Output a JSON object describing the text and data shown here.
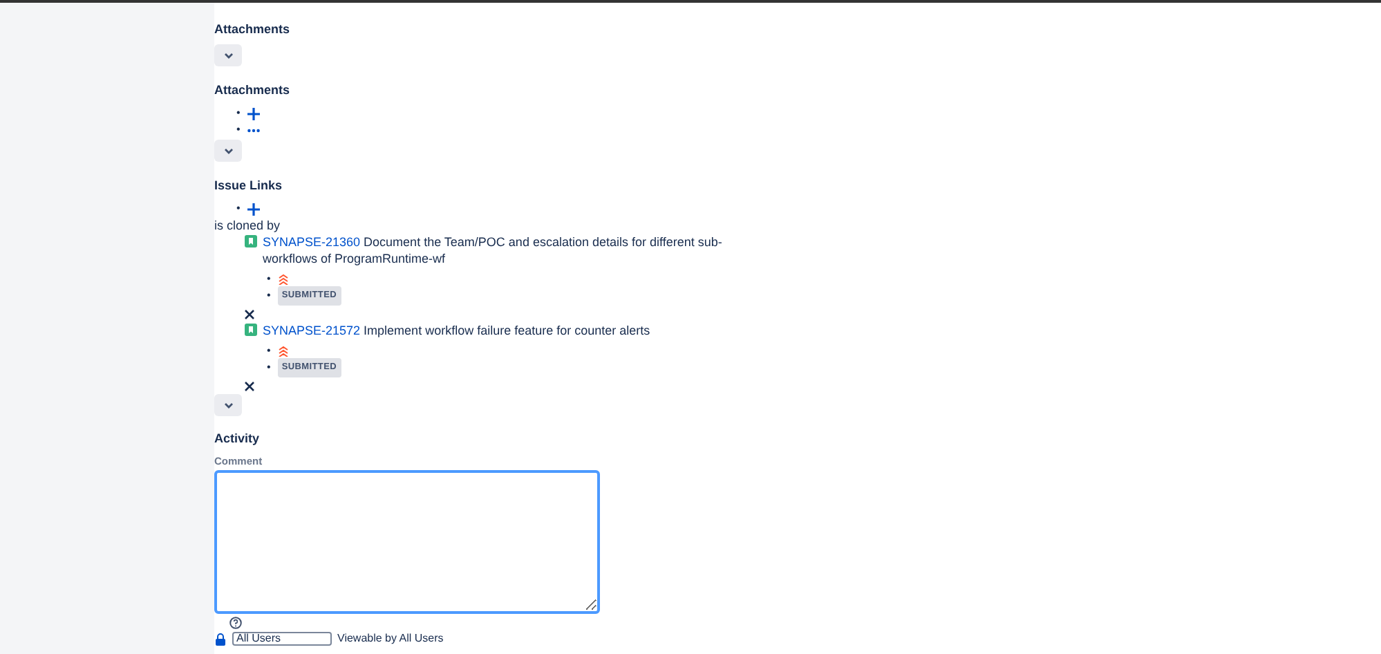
{
  "attachments_panel": {
    "title": "Attachments"
  },
  "attachments": {
    "title": "Attachments",
    "markers": [
      "•",
      "•"
    ]
  },
  "issue_links": {
    "title": "Issue Links",
    "add_marker": "•",
    "relation": "is cloned by",
    "links": [
      {
        "key": "SYNAPSE-21360",
        "summary": "Document the Team/POC and escalation details for different sub-workflows of ProgramRuntime-wf",
        "markers": [
          "•",
          "•"
        ],
        "status": "SUBMITTED"
      },
      {
        "key": "SYNAPSE-21572",
        "summary": "Implement workflow failure feature for counter alerts",
        "markers": [
          "•",
          "•"
        ],
        "status": "SUBMITTED"
      }
    ]
  },
  "activity": {
    "title": "Activity",
    "comment_label": "Comment",
    "comment_focused": true,
    "visibility_value": "All Users",
    "visibility_note": "Viewable by All Users"
  }
}
